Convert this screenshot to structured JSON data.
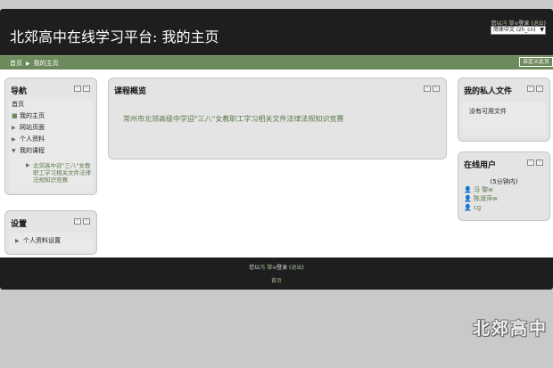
{
  "header": {
    "site_title": "北郊高中在线学习平台: 我的主页",
    "login_prefix": "您以",
    "login_user": "冯 黎w",
    "login_mid": "登录 (",
    "logout": "退出",
    "login_suffix": ")",
    "language": "简体中文 (zh_cn)"
  },
  "navbar": {
    "breadcrumb_home": "首页",
    "breadcrumb_sep": "▶",
    "breadcrumb_current": "我的主页",
    "customize_button": "自定义此页"
  },
  "navigation_block": {
    "title": "导航",
    "home": "首页",
    "items": [
      "我的主页",
      "网站页面",
      "个人资料",
      "我的课程"
    ],
    "course": "北郊高中迎\"三八\"女教职工学习相关文件法律法规知识竞赛"
  },
  "settings_block": {
    "title": "设置",
    "item": "个人资料设置"
  },
  "course_overview": {
    "title": "课程概览",
    "course_name": "常州市北郊高级中学迎\"三八\"女教职工学习相关文件法律法规知识竞赛"
  },
  "private_files": {
    "title": "我的私人文件",
    "empty": "没有可用文件"
  },
  "online_users": {
    "title": "在线用户",
    "period": "(5分钟内)",
    "users": [
      "冯 黎w",
      "陈淑萍w",
      "cg"
    ]
  },
  "footer": {
    "login_prefix": "您以",
    "login_user": "冯 黎w",
    "login_mid": "登录 (",
    "logout": "退出",
    "login_suffix": ")",
    "home": "首页"
  },
  "watermark": "北郊高中",
  "colors": {
    "header_bg": "#1e1e1e",
    "navbar_bg": "#6d8a5c",
    "link_green": "#5c7a4c",
    "block_bg": "#e4e4e4"
  }
}
